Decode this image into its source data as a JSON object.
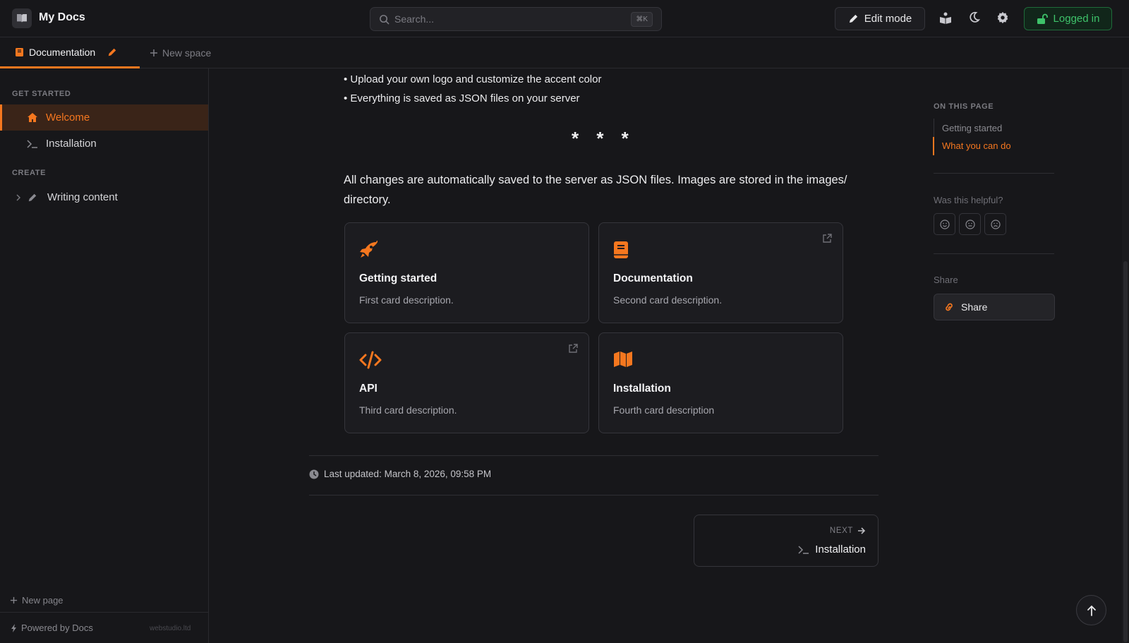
{
  "app": {
    "title": "My Docs"
  },
  "search": {
    "placeholder": "Search...",
    "shortcut": "⌘K"
  },
  "header": {
    "edit_mode_label": "Edit mode",
    "login_label": "Logged in"
  },
  "tabs": {
    "active_label": "Documentation",
    "new_space_label": "New space"
  },
  "sidebar": {
    "sections": [
      {
        "title": "GET STARTED",
        "items": [
          {
            "label": "Welcome",
            "icon": "home-icon",
            "active": true
          },
          {
            "label": "Installation",
            "icon": "terminal-icon",
            "active": false
          }
        ]
      },
      {
        "title": "CREATE",
        "items": [
          {
            "label": "Writing content",
            "icon": "pencil-icon",
            "active": false
          }
        ]
      }
    ],
    "new_page_label": "New page",
    "powered_by": "Powered by Docs",
    "domain": "webstudio.ltd"
  },
  "content": {
    "bullets": [
      "• Upload your own logo and customize the accent color",
      "• Everything is saved as JSON files on your server"
    ],
    "separator": "* * *",
    "paragraph": "All changes are automatically saved to the server as JSON files. Images are stored in the images/ directory.",
    "cards": [
      {
        "icon": "rocket-icon",
        "title": "Getting started",
        "description": "First card description.",
        "external": false
      },
      {
        "icon": "book-icon",
        "title": "Documentation",
        "description": "Second card description.",
        "external": true
      },
      {
        "icon": "code-icon",
        "title": "API",
        "description": "Third card description.",
        "external": true
      },
      {
        "icon": "map-icon",
        "title": "Installation",
        "description": "Fourth card description",
        "external": false
      }
    ],
    "last_updated": "Last updated: March 8, 2026, 09:58 PM",
    "next": {
      "label": "NEXT",
      "title": "Installation"
    }
  },
  "toc": {
    "heading": "ON THIS PAGE",
    "items": [
      {
        "label": "Getting started",
        "active": false
      },
      {
        "label": "What you can do",
        "active": true
      }
    ],
    "helpful_label": "Was this helpful?",
    "share_heading": "Share",
    "share_button": "Share"
  },
  "colors": {
    "accent": "#f5771f",
    "success": "#3ec26a",
    "background": "#17171a"
  }
}
